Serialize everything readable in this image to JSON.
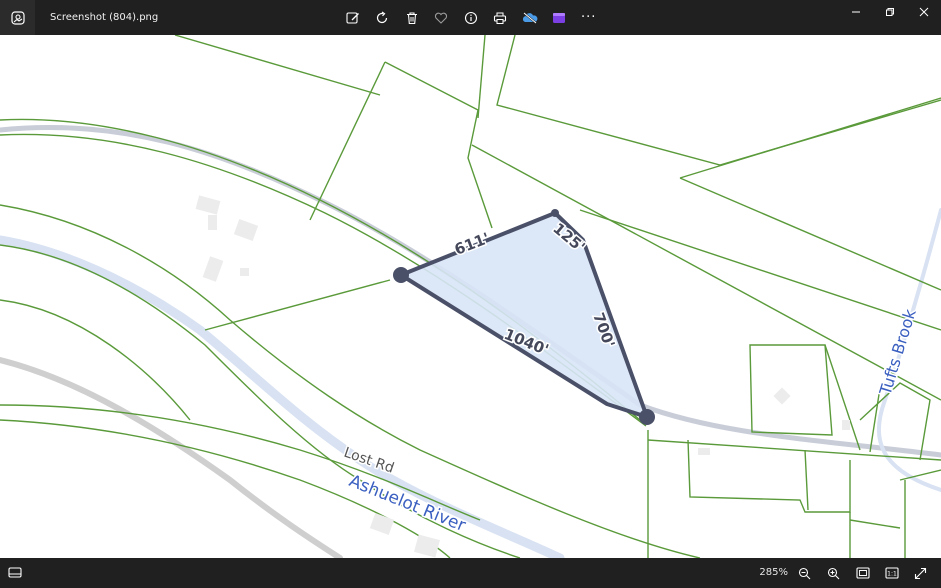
{
  "window": {
    "title": "Screenshot (804).png"
  },
  "toolbar": {
    "items": [
      {
        "icon": "edit-image-icon"
      },
      {
        "icon": "rotate-icon"
      },
      {
        "icon": "delete-icon"
      },
      {
        "icon": "favorite-icon"
      },
      {
        "icon": "info-icon"
      },
      {
        "icon": "print-icon"
      },
      {
        "icon": "onedrive-icon"
      },
      {
        "icon": "clipchamp-icon"
      },
      {
        "icon": "more-icon",
        "label": "···"
      }
    ]
  },
  "map": {
    "measurements": {
      "side_a": "611'",
      "side_b": "125'",
      "side_c": "700'",
      "side_d": "1040'"
    },
    "labels": {
      "road": "Lost Rd",
      "river": "Ashuelot River",
      "brook": "Tufts Brook"
    },
    "colors": {
      "parcel_lines": "#5a9a3a",
      "polygon_fill": "#d8e5f7",
      "polygon_stroke": "#4a5068",
      "water_label": "#3a5fc0",
      "road_label": "#555555"
    }
  },
  "status": {
    "zoom": "285%"
  }
}
